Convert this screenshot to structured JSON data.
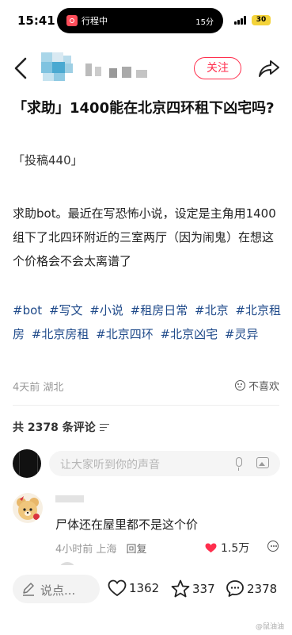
{
  "status_bar": {
    "time": "15:41",
    "activity_label": "行程中",
    "activity_time": "15分",
    "battery": "30"
  },
  "nav": {
    "follow_label": "关注"
  },
  "post": {
    "title": "「求助」1400能在北京四环租下凶宅吗?",
    "subtitle": "「投稿440」",
    "body": "求助bot。最近在写恐怖小说，设定是主角用1400组下了北四环附近的三室两厅（因为闹鬼）在想这个价格会不会太离谱了",
    "tags": [
      "#bot",
      "#写文",
      "#小说",
      "#租房日常",
      "#北京",
      "#北京租房",
      "#北京房租",
      "#北京四环",
      "#北京凶宅",
      "#灵异"
    ],
    "time_location": "4天前 湖北",
    "dislike_label": "不喜欢"
  },
  "comments": {
    "count_label": "共 2378 条评论",
    "input_placeholder": "让大家听到你的声音",
    "items": [
      {
        "text": "尸体还在屋里都不是这个价",
        "time_location": "4小时前 上海",
        "reply_label": "回复",
        "likes": "1.5万"
      }
    ]
  },
  "bottom_bar": {
    "say_label": "说点...",
    "likes": "1362",
    "stars": "337",
    "comments": "2378"
  },
  "watermark": "@鼠油油",
  "colors": {
    "accent_red": "#ff2e4d",
    "tag_blue": "#1f4a8a"
  }
}
